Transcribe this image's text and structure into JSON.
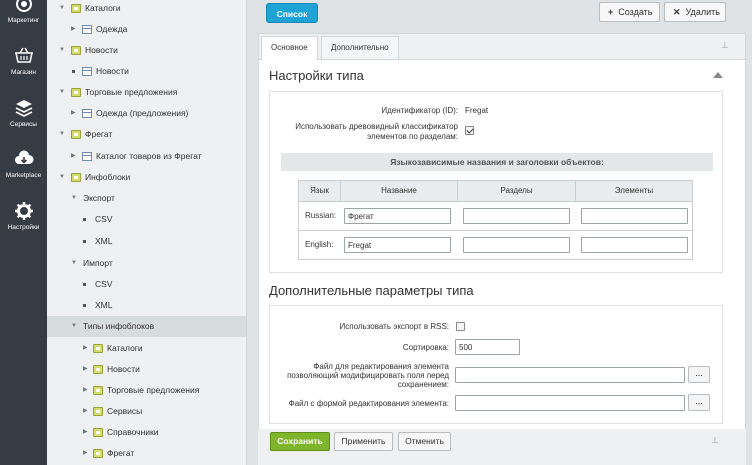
{
  "rail": [
    {
      "label": "Маркетинг",
      "icon": "target-icon"
    },
    {
      "label": "Магазин",
      "icon": "basket-icon"
    },
    {
      "label": "Сервисы",
      "icon": "layers-icon"
    },
    {
      "label": "Marketplace",
      "icon": "cloud-download-icon"
    },
    {
      "label": "Настройки",
      "icon": "gear-icon"
    }
  ],
  "tree": [
    {
      "label": "Каталоги"
    },
    {
      "label": "Одежда"
    },
    {
      "label": "Новости"
    },
    {
      "label": "Новости"
    },
    {
      "label": "Торговые предложения"
    },
    {
      "label": "Одежда (предложения)"
    },
    {
      "label": "Фрегат"
    },
    {
      "label": "Каталог товаров из Фрегат"
    },
    {
      "label": "Инфоблоки"
    },
    {
      "label": "Экспорт"
    },
    {
      "label": "CSV"
    },
    {
      "label": "XML"
    },
    {
      "label": "Импорт"
    },
    {
      "label": "CSV"
    },
    {
      "label": "XML"
    },
    {
      "label": "Типы инфоблоков"
    },
    {
      "label": "Каталоги"
    },
    {
      "label": "Новости"
    },
    {
      "label": "Торговые предложения"
    },
    {
      "label": "Сервисы"
    },
    {
      "label": "Справочники"
    },
    {
      "label": "Фрегат"
    }
  ],
  "toolbar": {
    "list_label": "Список",
    "create_label": "Создать",
    "delete_label": "Удалить"
  },
  "tabs": [
    {
      "label": "Основное"
    },
    {
      "label": "Дополнительно"
    }
  ],
  "type_settings": {
    "title": "Настройки типа",
    "id_label": "Идентификатор (ID):",
    "id_value": "Fregat",
    "tree_label_1": "Использовать древовидный классификатор",
    "tree_label_2": "элементов по разделам:",
    "tree_checked": true,
    "lang_header": "Языкозависимые названия и заголовки объектов:",
    "columns": [
      "Язык",
      "Название",
      "Разделы",
      "Элементы"
    ],
    "rows": [
      {
        "lang": "Russian:",
        "name": "Фрегат",
        "sections": "",
        "elements": ""
      },
      {
        "lang": "English:",
        "name": "Fregat",
        "sections": "",
        "elements": ""
      }
    ]
  },
  "extra_params": {
    "title": "Дополнительные параметры типа",
    "rss_label": "Использовать экспорт в RSS:",
    "rss_checked": false,
    "sort_label": "Сортировка:",
    "sort_value": "500",
    "edit_file_label_1": "Файл для редактирования элемента",
    "edit_file_label_2": "позволяющий модифицировать поля перед",
    "edit_file_label_3": "сохранением:",
    "edit_file_value": "",
    "form_file_label": "Файл с формой редактирования элемента:",
    "form_file_value": "",
    "browse_label": "..."
  },
  "footer": {
    "save_label": "Сохранить",
    "apply_label": "Применить",
    "cancel_label": "Отменить"
  },
  "colors": {
    "rail_bg": "#363c44",
    "list_button": "#1fa3d6",
    "save_button": "#7fb52a"
  }
}
